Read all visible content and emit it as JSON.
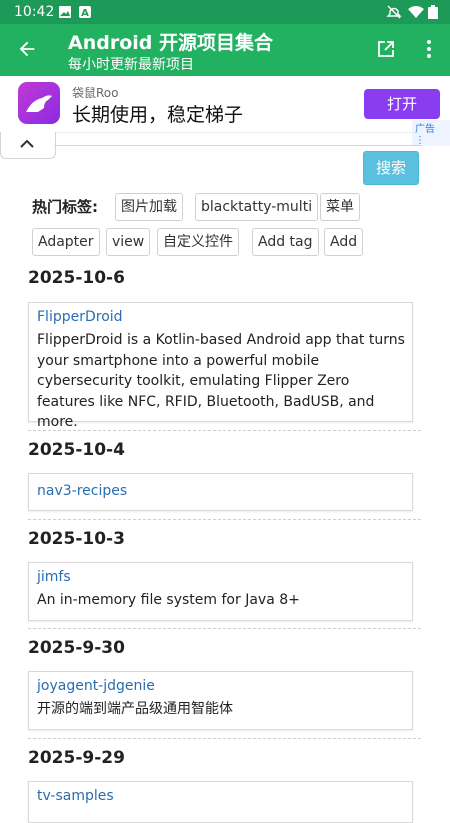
{
  "status_bar": {
    "time": "10:42",
    "icons": [
      "image-icon",
      "a-icon",
      "mute-icon",
      "wifi-icon",
      "battery-icon"
    ]
  },
  "app_bar": {
    "title": "Android 开源项目集合",
    "subtitle": "每小时更新最新项目",
    "back_icon": "arrow-left-icon",
    "share_icon": "share-icon",
    "more_icon": "more-vert-icon",
    "color": "#22b161"
  },
  "ad": {
    "brand": "袋鼠Roo",
    "slogan": "长期使用，稳定梯子",
    "button": "打开",
    "tag": "广告",
    "button_color": "#8a3cf0"
  },
  "search": {
    "button": "搜索",
    "collapse_icon": "chevron-up-icon"
  },
  "hot_tags": {
    "label": "热门标签:",
    "tags": [
      "图片加载",
      "blacktatty-multi",
      "菜单",
      "Adapter",
      "view",
      "自定义控件",
      "Add tag",
      "Add"
    ]
  },
  "sections": [
    {
      "date": "2025-10-6",
      "items": [
        {
          "name": "FlipperDroid",
          "desc": "FlipperDroid is a Kotlin-based Android app that turns your smartphone into a powerful mobile cybersecurity toolkit, emulating Flipper Zero features like NFC, RFID, Bluetooth, BadUSB, and more."
        }
      ]
    },
    {
      "date": "2025-10-4",
      "items": [
        {
          "name": "nav3-recipes",
          "desc": ""
        }
      ]
    },
    {
      "date": "2025-10-3",
      "items": [
        {
          "name": "jimfs",
          "desc": "An in-memory file system for Java 8+"
        }
      ]
    },
    {
      "date": "2025-9-30",
      "items": [
        {
          "name": "joyagent-jdgenie",
          "desc": "开源的端到端产品级通用智能体"
        }
      ]
    },
    {
      "date": "2025-9-29",
      "items": [
        {
          "name": "tv-samples",
          "desc": ""
        }
      ]
    }
  ]
}
